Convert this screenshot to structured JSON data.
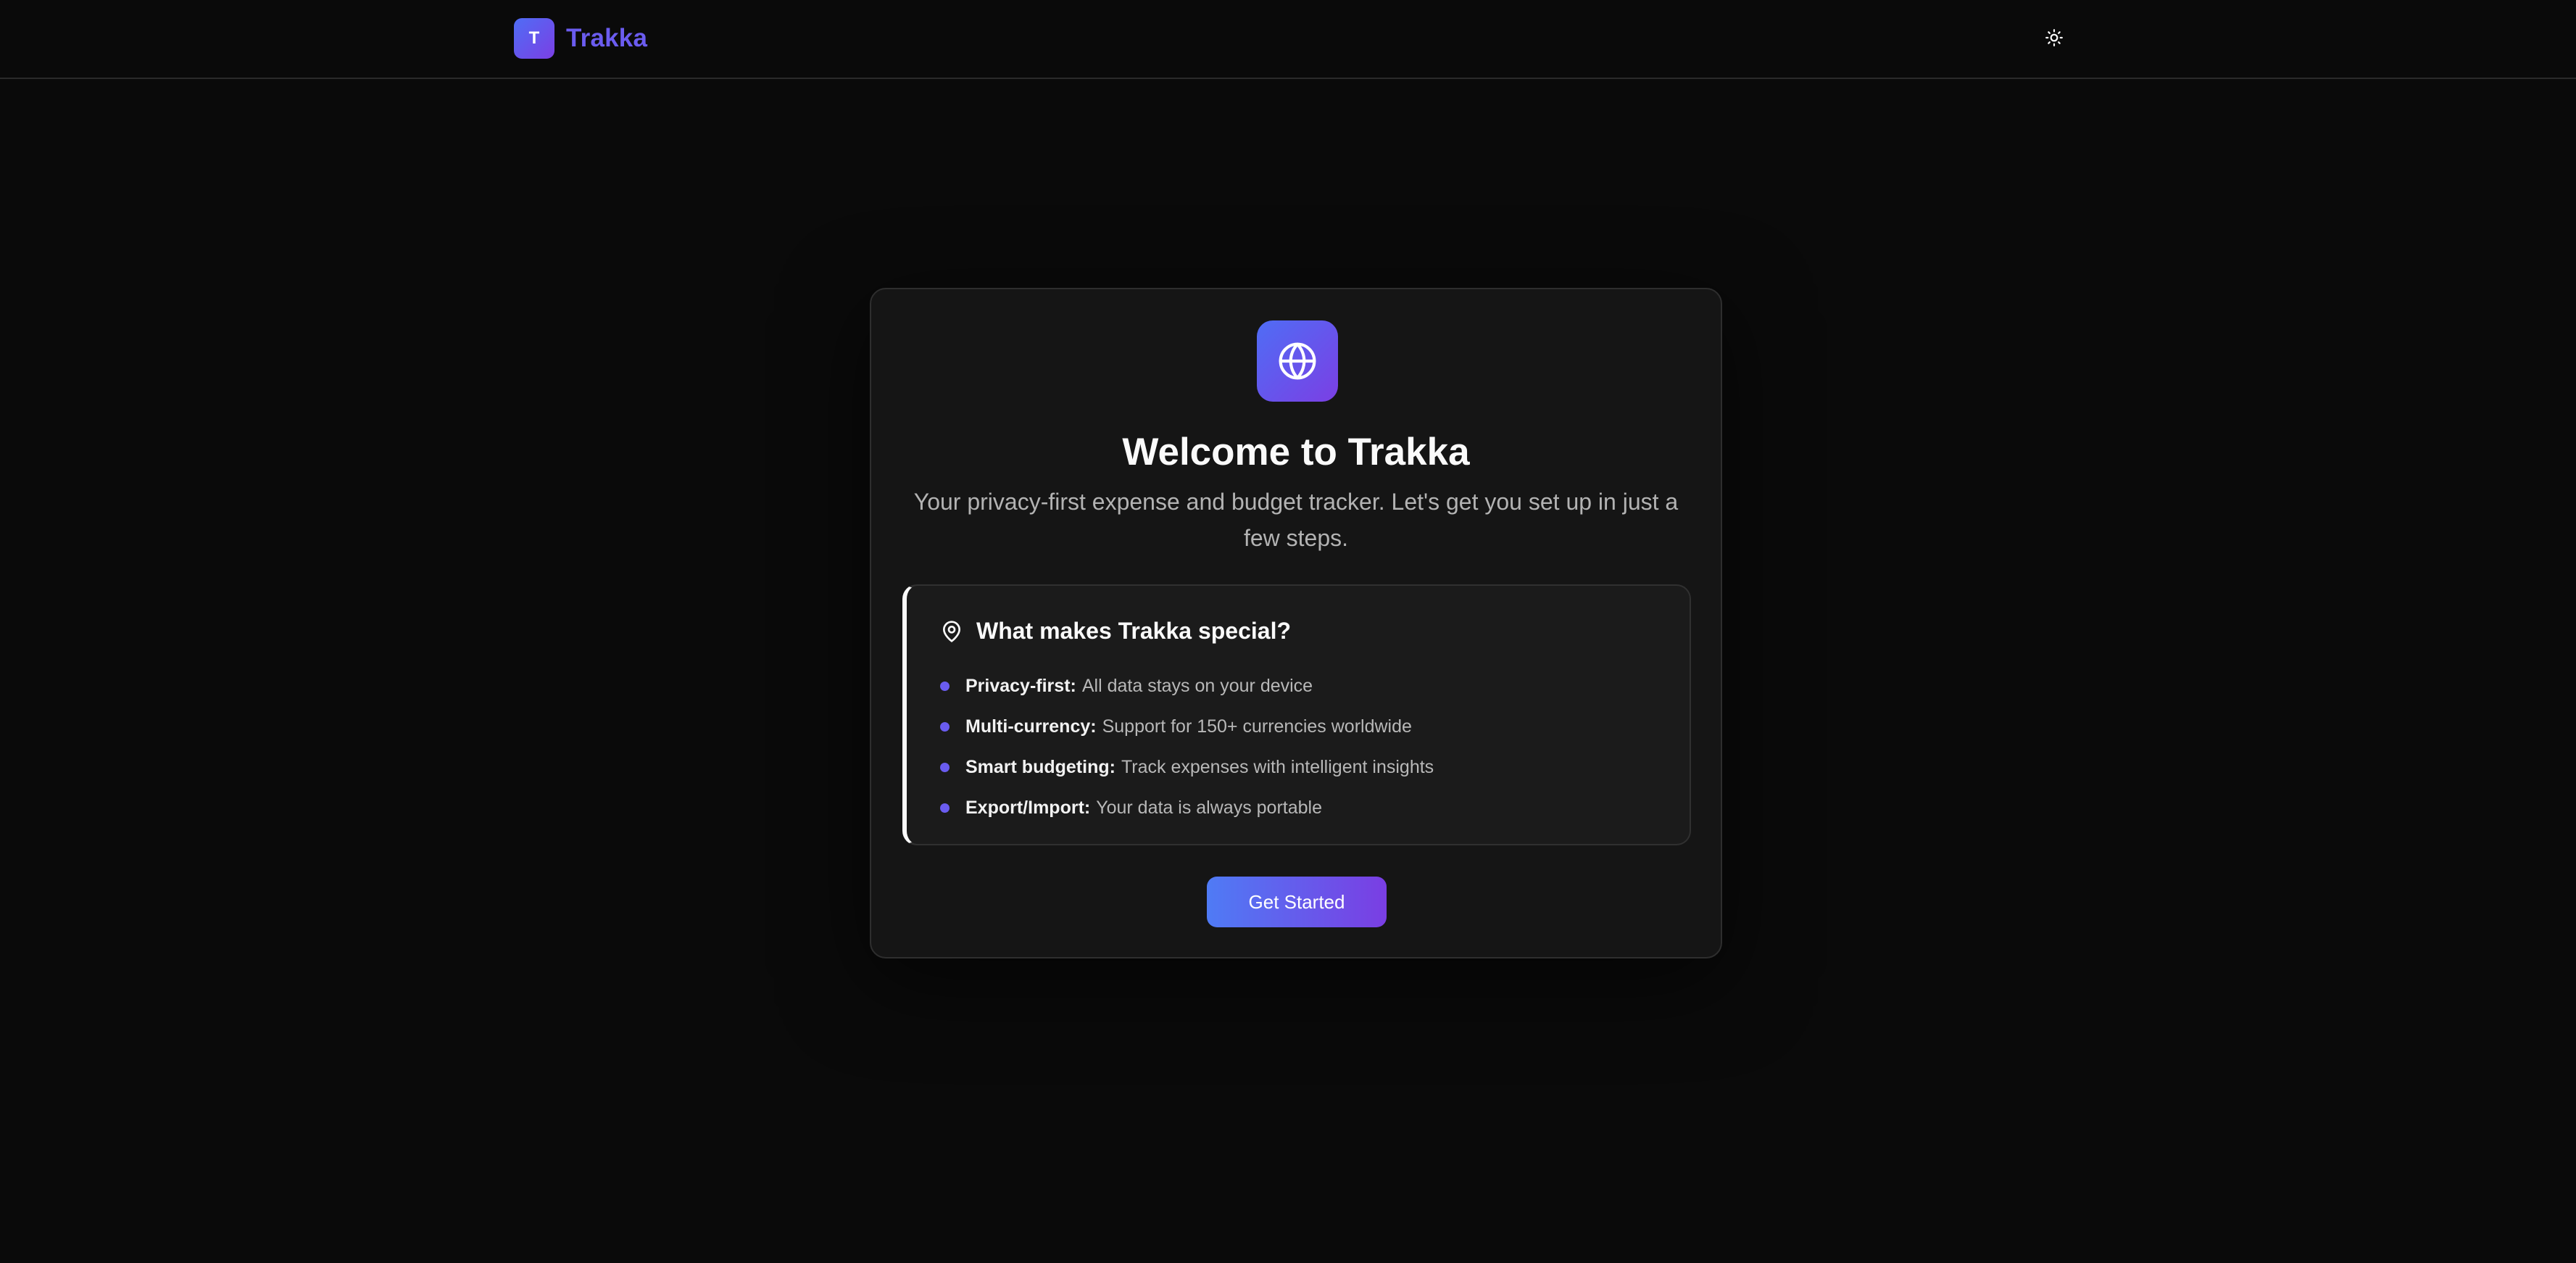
{
  "header": {
    "logo_letter": "T",
    "app_name": "Trakka",
    "theme_toggle_icon": "sun-icon"
  },
  "welcome": {
    "icon": "globe-icon",
    "title": "Welcome to Trakka",
    "subtitle": "Your privacy-first expense and budget tracker. Let's get you set up in just a few steps."
  },
  "features": {
    "icon": "location-pin-icon",
    "title": "What makes Trakka special?",
    "items": [
      {
        "label": "Privacy-first:",
        "text": "All data stays on your device"
      },
      {
        "label": "Multi-currency:",
        "text": "Support for 150+ currencies worldwide"
      },
      {
        "label": "Smart budgeting:",
        "text": "Track expenses with intelligent insights"
      },
      {
        "label": "Export/Import:",
        "text": "Your data is always portable"
      }
    ]
  },
  "actions": {
    "get_started_label": "Get Started"
  },
  "colors": {
    "background": "#0a0a0a",
    "card": "#151515",
    "accent_start": "#4f6df5",
    "accent_end": "#7b3fe4",
    "brand_text": "#6b5cf0",
    "bullet": "#6a5cf0"
  }
}
